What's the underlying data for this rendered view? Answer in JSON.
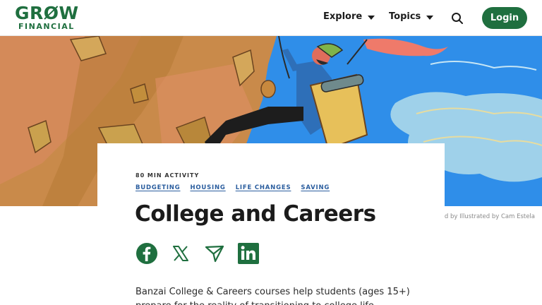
{
  "header": {
    "logo_line1": "GRØW",
    "logo_line2": "FINANCIAL",
    "nav": [
      {
        "label": "Explore"
      },
      {
        "label": "Topics"
      }
    ],
    "login_label": "Login"
  },
  "hero": {
    "credit": "Illustrated by Illustrated by Cam Estela"
  },
  "article": {
    "activity": "80 MIN ACTIVITY",
    "tags": [
      "BUDGETING",
      "HOUSING",
      "LIFE CHANGES",
      "SAVING"
    ],
    "title": "College and Careers",
    "share": [
      {
        "icon": "facebook-icon"
      },
      {
        "icon": "x-icon"
      },
      {
        "icon": "send-icon"
      },
      {
        "icon": "linkedin-icon"
      }
    ],
    "description_line1": "Banzai College & Careers courses help students (ages 15+)",
    "description_line2": "prepare for the reality of transitioning to college life"
  },
  "colors": {
    "brand_green": "#1f6f3f",
    "tag_blue": "#2a5d9e",
    "sky_blue": "#2f8ee9"
  }
}
